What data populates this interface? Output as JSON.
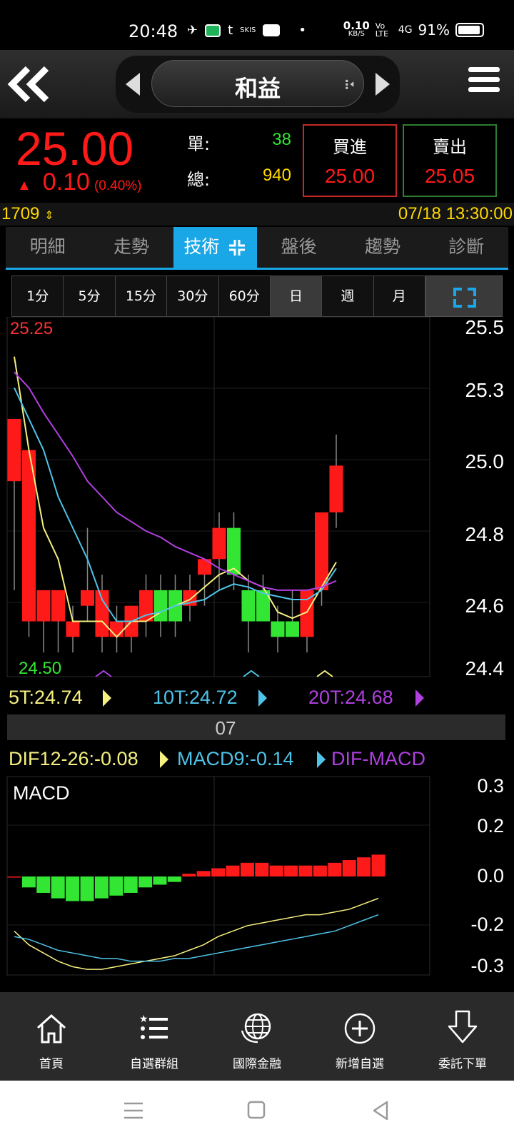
{
  "status_bar": {
    "time": "20:48",
    "net_speed_value": "0.10",
    "net_speed_unit": "KB/S",
    "volte": "Vo LTE",
    "signal": "4G",
    "battery": "91%"
  },
  "header": {
    "stock_name": "和益"
  },
  "quote": {
    "price": "25.00",
    "change": "0.10",
    "change_pct": "(0.40%)",
    "single_label": "單:",
    "single_value": "38",
    "total_label": "總:",
    "total_value": "940",
    "buy_label": "買進",
    "buy_price": "25.00",
    "sell_label": "賣出",
    "sell_price": "25.05"
  },
  "info": {
    "code": "1709",
    "datetime": "07/18 13:30:00"
  },
  "tabs": [
    "明細",
    "走勢",
    "技術",
    "盤後",
    "趨勢",
    "診斷"
  ],
  "periods": [
    "1分",
    "5分",
    "15分",
    "30分",
    "60分",
    "日",
    "週",
    "月"
  ],
  "chart": {
    "high_label": "25.25",
    "low_label": "24.50",
    "y_labels": [
      "25.5",
      "25.3",
      "25.0",
      "24.8",
      "24.6",
      "24.4"
    ],
    "ma5": "5T:24.74",
    "ma10": "10T:24.72",
    "ma20": "20T:24.68",
    "date_label": "07",
    "macd_dif": "DIF12-26:-0.08",
    "macd_macd": "MACD9:-0.14",
    "macd_osc": "DIF-MACD",
    "macd_title": "MACD",
    "macd_y_labels": [
      "0.3",
      "0.2",
      "0.0",
      "-0.2",
      "-0.3"
    ]
  },
  "chart_data": {
    "type": "candlestick",
    "ylim": [
      24.4,
      25.5
    ],
    "candles": [
      {
        "o": 25.0,
        "h": 25.2,
        "l": 24.65,
        "c": 25.2
      },
      {
        "o": 24.55,
        "h": 25.1,
        "l": 24.5,
        "c": 25.1
      },
      {
        "o": 24.55,
        "h": 24.65,
        "l": 24.45,
        "c": 24.65
      },
      {
        "o": 24.55,
        "h": 24.65,
        "l": 24.45,
        "c": 24.65
      },
      {
        "o": 24.5,
        "h": 24.6,
        "l": 24.45,
        "c": 24.55
      },
      {
        "o": 24.6,
        "h": 24.85,
        "l": 24.55,
        "c": 24.65
      },
      {
        "o": 24.5,
        "h": 24.7,
        "l": 24.45,
        "c": 24.65
      },
      {
        "o": 24.5,
        "h": 24.6,
        "l": 24.45,
        "c": 24.55
      },
      {
        "o": 24.5,
        "h": 24.6,
        "l": 24.45,
        "c": 24.6
      },
      {
        "o": 24.55,
        "h": 24.7,
        "l": 24.5,
        "c": 24.65
      },
      {
        "o": 24.65,
        "h": 24.7,
        "l": 24.5,
        "c": 24.55
      },
      {
        "o": 24.65,
        "h": 24.7,
        "l": 24.5,
        "c": 24.55
      },
      {
        "o": 24.6,
        "h": 24.7,
        "l": 24.55,
        "c": 24.65
      },
      {
        "o": 24.7,
        "h": 24.75,
        "l": 24.6,
        "c": 24.75
      },
      {
        "o": 24.75,
        "h": 24.9,
        "l": 24.65,
        "c": 24.85
      },
      {
        "o": 24.85,
        "h": 24.9,
        "l": 24.65,
        "c": 24.7
      },
      {
        "o": 24.65,
        "h": 24.7,
        "l": 24.45,
        "c": 24.55
      },
      {
        "o": 24.65,
        "h": 24.7,
        "l": 24.55,
        "c": 24.55
      },
      {
        "o": 24.55,
        "h": 24.6,
        "l": 24.45,
        "c": 24.5
      },
      {
        "o": 24.55,
        "h": 24.65,
        "l": 24.5,
        "c": 24.5
      },
      {
        "o": 24.5,
        "h": 24.65,
        "l": 24.45,
        "c": 24.65
      },
      {
        "o": 24.65,
        "h": 24.9,
        "l": 24.6,
        "c": 24.9
      },
      {
        "o": 24.9,
        "h": 25.15,
        "l": 24.85,
        "c": 25.05
      }
    ],
    "ma5": [
      25.4,
      25.1,
      24.85,
      24.75,
      24.55,
      24.55,
      24.55,
      24.5,
      24.55,
      24.55,
      24.58,
      24.6,
      24.62,
      24.66,
      24.7,
      24.72,
      24.68,
      24.66,
      24.58,
      24.56,
      24.58,
      24.66,
      24.74
    ],
    "ma10": [
      25.3,
      25.2,
      25.1,
      24.95,
      24.85,
      24.75,
      24.62,
      24.55,
      24.55,
      24.57,
      24.58,
      24.6,
      24.61,
      24.62,
      24.65,
      24.67,
      24.66,
      24.64,
      24.63,
      24.62,
      24.62,
      24.65,
      24.72
    ],
    "ma20": [
      25.35,
      25.3,
      25.22,
      25.15,
      25.08,
      25.0,
      24.95,
      24.9,
      24.87,
      24.84,
      24.82,
      24.79,
      24.77,
      24.75,
      24.72,
      24.7,
      24.68,
      24.66,
      24.65,
      24.65,
      24.65,
      24.66,
      24.68
    ],
    "macd_ylim": [
      -0.35,
      0.35
    ],
    "osc": [
      0,
      -0.04,
      -0.06,
      -0.08,
      -0.09,
      -0.09,
      -0.08,
      -0.07,
      -0.06,
      -0.04,
      -0.03,
      -0.02,
      0.01,
      0.02,
      0.03,
      0.04,
      0.05,
      0.05,
      0.04,
      0.04,
      0.04,
      0.04,
      0.05,
      0.06,
      0.07,
      0.08
    ],
    "dif": [
      -0.2,
      -0.25,
      -0.28,
      -0.31,
      -0.33,
      -0.34,
      -0.34,
      -0.33,
      -0.32,
      -0.31,
      -0.3,
      -0.29,
      -0.27,
      -0.25,
      -0.22,
      -0.2,
      -0.18,
      -0.17,
      -0.16,
      -0.15,
      -0.14,
      -0.14,
      -0.13,
      -0.12,
      -0.1,
      -0.08
    ],
    "macd": [
      -0.22,
      -0.23,
      -0.25,
      -0.27,
      -0.28,
      -0.29,
      -0.3,
      -0.3,
      -0.31,
      -0.31,
      -0.31,
      -0.3,
      -0.3,
      -0.29,
      -0.28,
      -0.27,
      -0.26,
      -0.25,
      -0.24,
      -0.23,
      -0.22,
      -0.21,
      -0.2,
      -0.18,
      -0.16,
      -0.14
    ]
  },
  "bottom_nav": [
    "首頁",
    "自選群組",
    "國際金融",
    "新增自選",
    "委託下單"
  ]
}
